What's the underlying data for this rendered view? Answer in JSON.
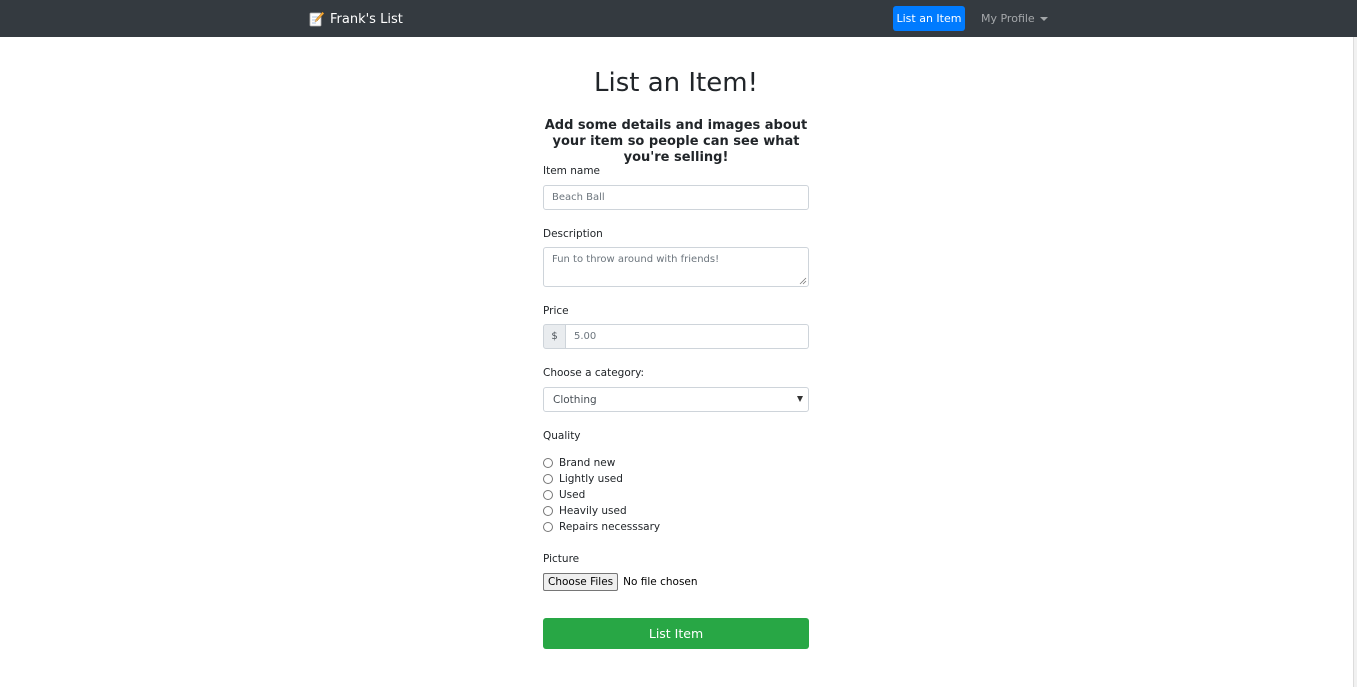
{
  "navbar": {
    "brand": "Frank's List",
    "brand_icon": "memo-icon",
    "list_button": "List an Item",
    "profile_menu": "My Profile"
  },
  "form": {
    "title": "List an Item!",
    "subtitle": "Add some details and images about your item so people can see what you're selling!",
    "item_name": {
      "label": "Item name",
      "placeholder": "Beach Ball"
    },
    "description": {
      "label": "Description",
      "placeholder": "Fun to throw around with friends!"
    },
    "price": {
      "label": "Price",
      "prefix": "$",
      "placeholder": "5.00"
    },
    "category": {
      "label": "Choose a category:",
      "selected": "Clothing"
    },
    "quality": {
      "label": "Quality",
      "options": [
        "Brand new",
        "Lightly used",
        "Used",
        "Heavily used",
        "Repairs necesssary"
      ]
    },
    "picture": {
      "label": "Picture",
      "button": "Choose Files",
      "status": "No file chosen"
    },
    "submit": "List Item"
  },
  "colors": {
    "navbar_bg": "#343a40",
    "primary": "#007bff",
    "success": "#28a745"
  }
}
